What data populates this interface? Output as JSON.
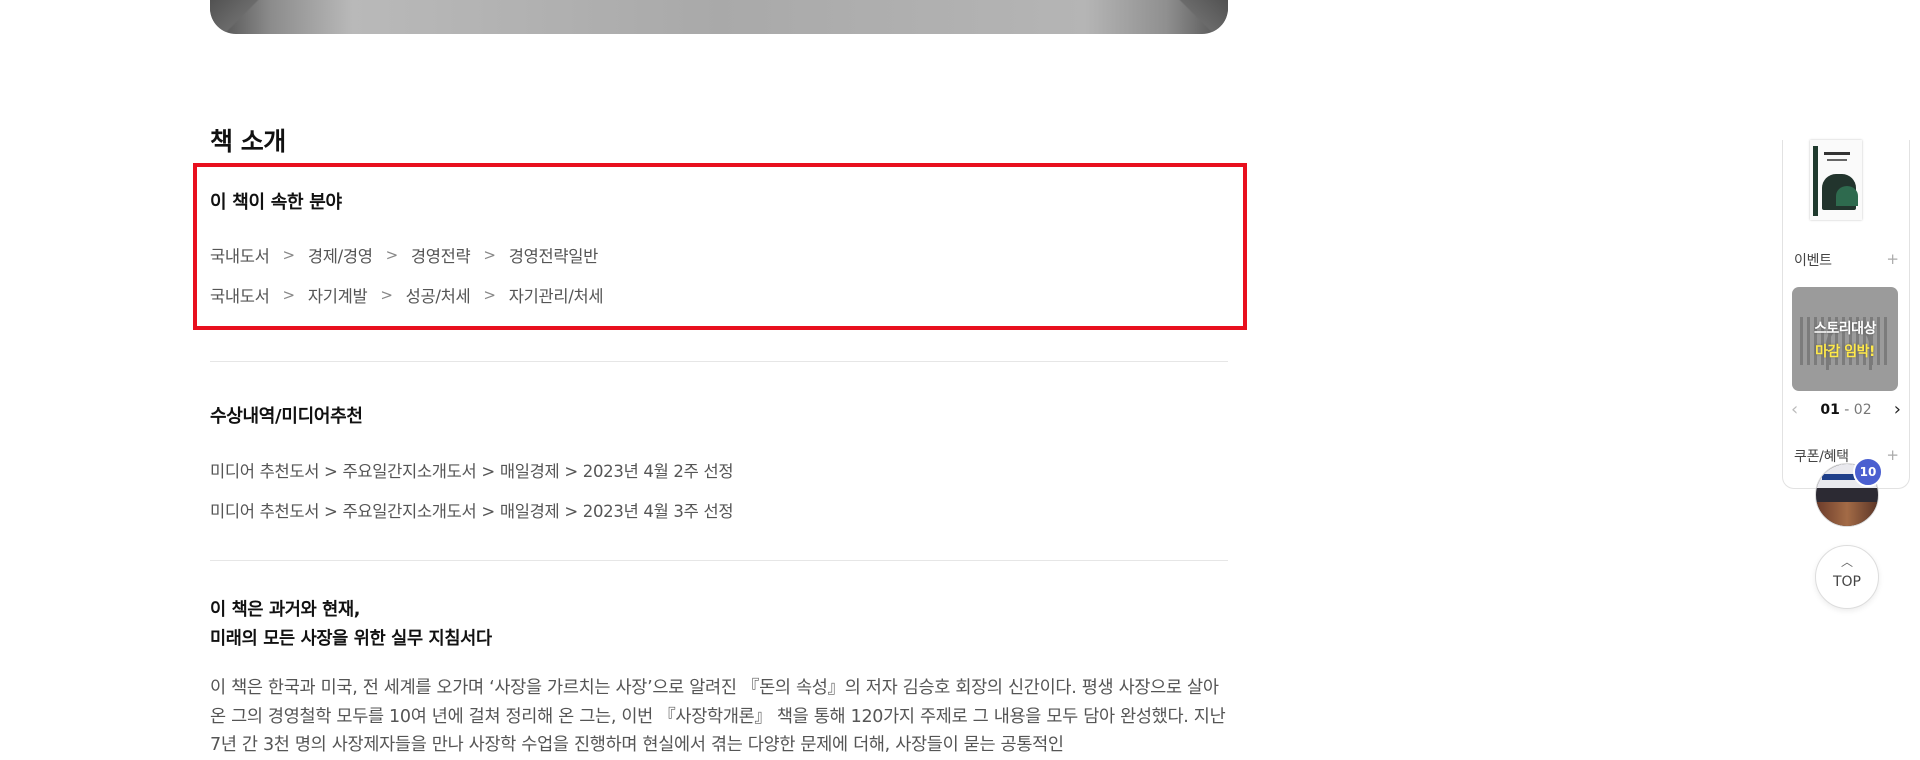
{
  "book_intro": {
    "section_title": "책 소개",
    "category": {
      "title": "이 책이 속한 분야",
      "separator": ">",
      "paths": [
        [
          "국내도서",
          "경제/경영",
          "경영전략",
          "경영전략일반"
        ],
        [
          "국내도서",
          "자기계발",
          "성공/처세",
          "자기관리/처세"
        ]
      ]
    },
    "awards": {
      "title": "수상내역/미디어추천",
      "items": [
        "미디어 추천도서 > 주요일간지소개도서 > 매일경제 > 2023년 4월 2주 선정",
        "미디어 추천도서 > 주요일간지소개도서 > 매일경제 > 2023년 4월 3주 선정"
      ]
    },
    "intro": {
      "heading_line1": "이 책은 과거와 현재,",
      "heading_line2": "미래의 모든 사장을 위한 실무 지침서다",
      "body": "이 책은 한국과 미국, 전 세계를 오가며 ‘사장을 가르치는 사장’으로 알려진 『돈의 속성』의 저자 김승호 회장의 신간이다. 평생 사장으로 살아온 그의 경영철학 모두를 10여 년에 걸쳐 정리해 온 그는, 이번 『사장학개론』 책을 통해 120가지 주제로 그 내용을 모두 담아 완성했다. 지난 7년 간 3천 명의 사장제자들을 만나 사장학 수업을 진행하며 현실에서 겪는 다양한 문제에 더해, 사장들이 묻는 공통적인"
    }
  },
  "side_panel": {
    "event_label": "이벤트",
    "plus": "+",
    "banner": {
      "line1": "스토리대상",
      "line2": "마감 임박!"
    },
    "pager": {
      "prev": "‹",
      "next": "›",
      "current": "01",
      "separator": " - ",
      "total": "02"
    },
    "coupon_label": "쿠폰/혜택"
  },
  "recent": {
    "badge": "10"
  },
  "top_button": {
    "arrow": "︿",
    "label": "TOP"
  }
}
